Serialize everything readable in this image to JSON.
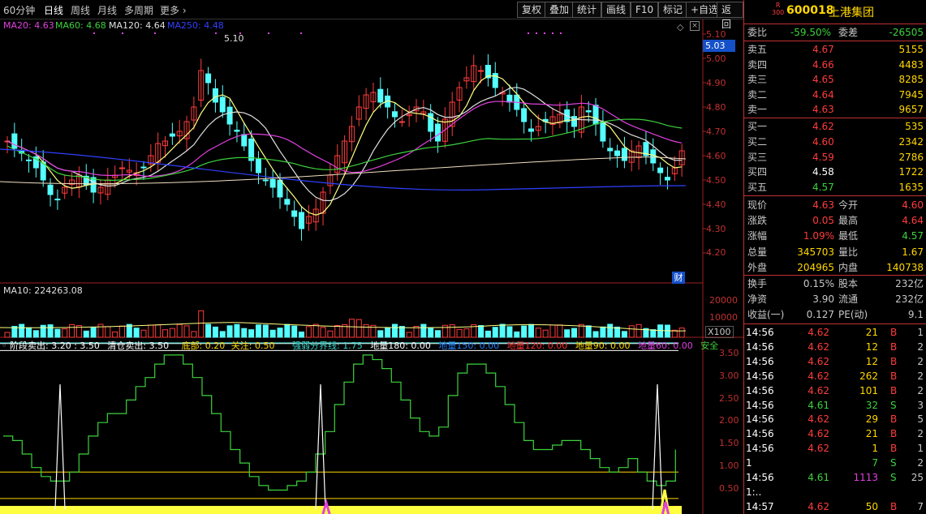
{
  "toolbar": {
    "periods": [
      "60分钟",
      "日线",
      "周线",
      "月线",
      "多周期",
      "更多"
    ],
    "buttons": [
      "复权",
      "叠加",
      "统计",
      "画线",
      "F10",
      "标记",
      "+自选",
      "返回"
    ]
  },
  "ma_legend": [
    {
      "label": "MA20: 4.63",
      "color": "#e040e0"
    },
    {
      "label": "MA60: 4.68",
      "color": "#3cd23c"
    },
    {
      "label": "MA120: 4.64",
      "color": "#e0e0e0"
    },
    {
      "label": "MA250: 4.48",
      "color": "#3040ff"
    }
  ],
  "price_axis": {
    "labels": [
      "5.10",
      "5.00",
      "4.90",
      "4.80",
      "4.70",
      "4.60",
      "4.50",
      "4.40",
      "4.30",
      "4.20"
    ],
    "current": "5.03",
    "high_mark": "5.10"
  },
  "badge_cai": "财",
  "volume": {
    "legend": "MA10: 224263.08",
    "axis_labels": [
      "20000",
      "10000",
      "X100"
    ]
  },
  "indicator": {
    "legend": [
      {
        "text": "阶段卖出: 3.20 : 3.50",
        "color": "#ffffff"
      },
      {
        "text": "清仓卖出: 3.50",
        "color": "#ffffff"
      },
      {
        "text": "底部: 0.20",
        "color": "#ffd700"
      },
      {
        "text": "关注: 0.50",
        "color": "#ffd700"
      },
      {
        "text": "强弱分界线: 1.75",
        "color": "#3cd2c8"
      },
      {
        "text": "地量180: 0.00",
        "color": "#ffffff"
      },
      {
        "text": "地量150: 0.00",
        "color": "#2080ff"
      },
      {
        "text": "地量120: 0.00",
        "color": "#ff3030"
      },
      {
        "text": "地量90: 0.00",
        "color": "#ffd700"
      },
      {
        "text": "地量60: 0.00",
        "color": "#e040e0"
      },
      {
        "text": "安全",
        "color": "#3cd23c"
      }
    ],
    "axis_labels": [
      "3.50",
      "3.00",
      "2.50",
      "2.00",
      "1.50",
      "1.00",
      "0.50"
    ]
  },
  "stock": {
    "badge_top": "R",
    "badge_bottom": "300",
    "code": "600018",
    "name": "上港集团"
  },
  "weibi": {
    "label": "委比",
    "value": "-59.50%",
    "label2": "委差",
    "value2": "-26505"
  },
  "asks": [
    {
      "label": "卖五",
      "price": "4.67",
      "vol": "5155"
    },
    {
      "label": "卖四",
      "price": "4.66",
      "vol": "4483"
    },
    {
      "label": "卖三",
      "price": "4.65",
      "vol": "8285"
    },
    {
      "label": "卖二",
      "price": "4.64",
      "vol": "7945"
    },
    {
      "label": "卖一",
      "price": "4.63",
      "vol": "9657"
    }
  ],
  "bids": [
    {
      "label": "买一",
      "price": "4.62",
      "vol": "535"
    },
    {
      "label": "买二",
      "price": "4.60",
      "vol": "2342"
    },
    {
      "label": "买三",
      "price": "4.59",
      "vol": "2786"
    },
    {
      "label": "买四",
      "price": "4.58",
      "vol": "1722"
    },
    {
      "label": "买五",
      "price": "4.57",
      "vol": "1635"
    }
  ],
  "quote": [
    {
      "l1": "现价",
      "v1": "4.63",
      "l2": "今开",
      "v2": "4.60"
    },
    {
      "l1": "涨跌",
      "v1": "0.05",
      "l2": "最高",
      "v2": "4.64"
    },
    {
      "l1": "涨幅",
      "v1": "1.09%",
      "l2": "最低",
      "v2": "4.57"
    },
    {
      "l1": "总量",
      "v1": "345703",
      "l2": "量比",
      "v2": "1.67"
    },
    {
      "l1": "外盘",
      "v1": "204965",
      "l2": "内盘",
      "v2": "140738"
    }
  ],
  "fund": [
    {
      "l1": "换手",
      "v1": "0.15%",
      "l2": "股本",
      "v2": "232亿"
    },
    {
      "l1": "净资",
      "v1": "3.90",
      "l2": "流通",
      "v2": "232亿"
    },
    {
      "l1": "收益(一)",
      "v1": "0.127",
      "l2": "PE(动)",
      "v2": "9.1"
    }
  ],
  "ticks": [
    {
      "time": "14:56",
      "price": "4.62",
      "vol": "21",
      "bs": "B",
      "n": "1"
    },
    {
      "time": "14:56",
      "price": "4.62",
      "vol": "12",
      "bs": "B",
      "n": "2"
    },
    {
      "time": "14:56",
      "price": "4.62",
      "vol": "12",
      "bs": "B",
      "n": "2"
    },
    {
      "time": "14:56",
      "price": "4.62",
      "vol": "262",
      "bs": "B",
      "n": "2"
    },
    {
      "time": "14:56",
      "price": "4.62",
      "vol": "101",
      "bs": "B",
      "n": "2"
    },
    {
      "time": "14:56",
      "price": "4.61",
      "vol": "32",
      "bs": "S",
      "n": "3"
    },
    {
      "time": "14:56",
      "price": "4.62",
      "vol": "29",
      "bs": "B",
      "n": "5"
    },
    {
      "time": "14:56",
      "price": "4.62",
      "vol": "21",
      "bs": "B",
      "n": "2"
    },
    {
      "time": "14:56",
      "price": "4.62",
      "vol": "1",
      "bs": "B",
      "n": "1"
    },
    {
      "time": "1",
      "price": "",
      "vol": "7",
      "bs": "S",
      "n": "2"
    },
    {
      "time": "14:56",
      "price": "4.61",
      "vol": "1113",
      "bs": "S",
      "n": "25"
    },
    {
      "time": "1:..",
      "price": "",
      "vol": "",
      "bs": "",
      "n": ""
    },
    {
      "time": "14:57",
      "price": "4.62",
      "vol": "50",
      "bs": "B",
      "n": "7"
    }
  ]
}
